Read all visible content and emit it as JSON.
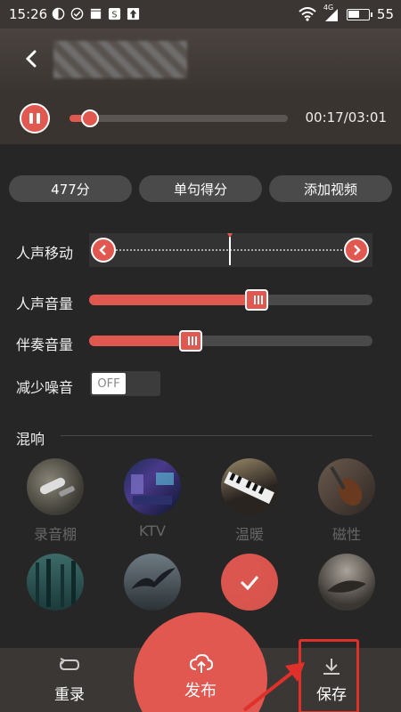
{
  "status_bar": {
    "time": "15:26",
    "signal_label": "4G",
    "battery_level": "55"
  },
  "player": {
    "time": "00:17/03:01",
    "progress": 0.095
  },
  "pills": [
    {
      "label": "477分"
    },
    {
      "label": "单句得分"
    },
    {
      "label": "添加视频"
    }
  ],
  "controls": {
    "vocal_shift_label": "人声移动",
    "vocal_volume_label": "人声音量",
    "vocal_volume_value": 0.59,
    "accomp_volume_label": "伴奏音量",
    "accomp_volume_value": 0.36,
    "noise_label": "减少噪音",
    "noise_toggle_text": "OFF"
  },
  "reverb": {
    "title": "混响",
    "row1": [
      {
        "label": "录音棚",
        "icon": "microphone-image"
      },
      {
        "label": "KTV",
        "icon": "ktv-room-image"
      },
      {
        "label": "温暖",
        "icon": "piano-image"
      },
      {
        "label": "磁性",
        "icon": "violin-image"
      }
    ],
    "row2": [
      {
        "label": "",
        "icon": "forest-image"
      },
      {
        "label": "",
        "icon": "bird-image"
      },
      {
        "label": "",
        "icon": "selected-check-icon",
        "selected": true
      },
      {
        "label": "",
        "icon": "leaf-image"
      }
    ]
  },
  "bottom": {
    "rerecord_label": "重录",
    "publish_label": "发布",
    "save_label": "保存"
  },
  "colors": {
    "accent": "#e0584f",
    "background": "#262626",
    "annotation": "#e0302a"
  }
}
